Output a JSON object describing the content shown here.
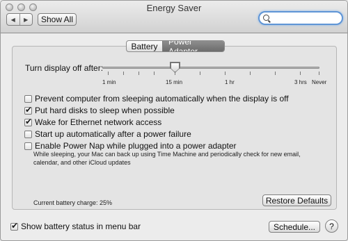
{
  "window": {
    "title": "Energy Saver"
  },
  "toolbar": {
    "back_icon": "◀",
    "forward_icon": "▶",
    "show_all_label": "Show All",
    "search_value": ""
  },
  "tabs": {
    "battery": "Battery",
    "power_adapter": "Power Adapter",
    "selected": "Power Adapter"
  },
  "slider": {
    "label": "Turn display off after:",
    "ticks": [
      "1 min",
      "15 min",
      "1 hr",
      "3 hrs",
      "Never"
    ],
    "value": "15 min"
  },
  "options": [
    {
      "label": "Prevent computer from sleeping automatically when the display is off",
      "checked": false
    },
    {
      "label": "Put hard disks to sleep when possible",
      "checked": true
    },
    {
      "label": "Wake for Ethernet network access",
      "checked": true
    },
    {
      "label": "Start up automatically after a power failure",
      "checked": false
    },
    {
      "label": "Enable Power Nap while plugged into a power adapter",
      "checked": false
    }
  ],
  "power_nap_note_line1": "While sleeping, your Mac can back up using Time Machine and periodically check for new email,",
  "power_nap_note_line2": "calendar, and other iCloud updates",
  "battery_charge": "Current battery charge: 25%",
  "restore_defaults_label": "Restore Defaults",
  "show_battery_status": {
    "label": "Show battery status in menu bar",
    "checked": true
  },
  "schedule_label": "Schedule...",
  "help_label": "?"
}
